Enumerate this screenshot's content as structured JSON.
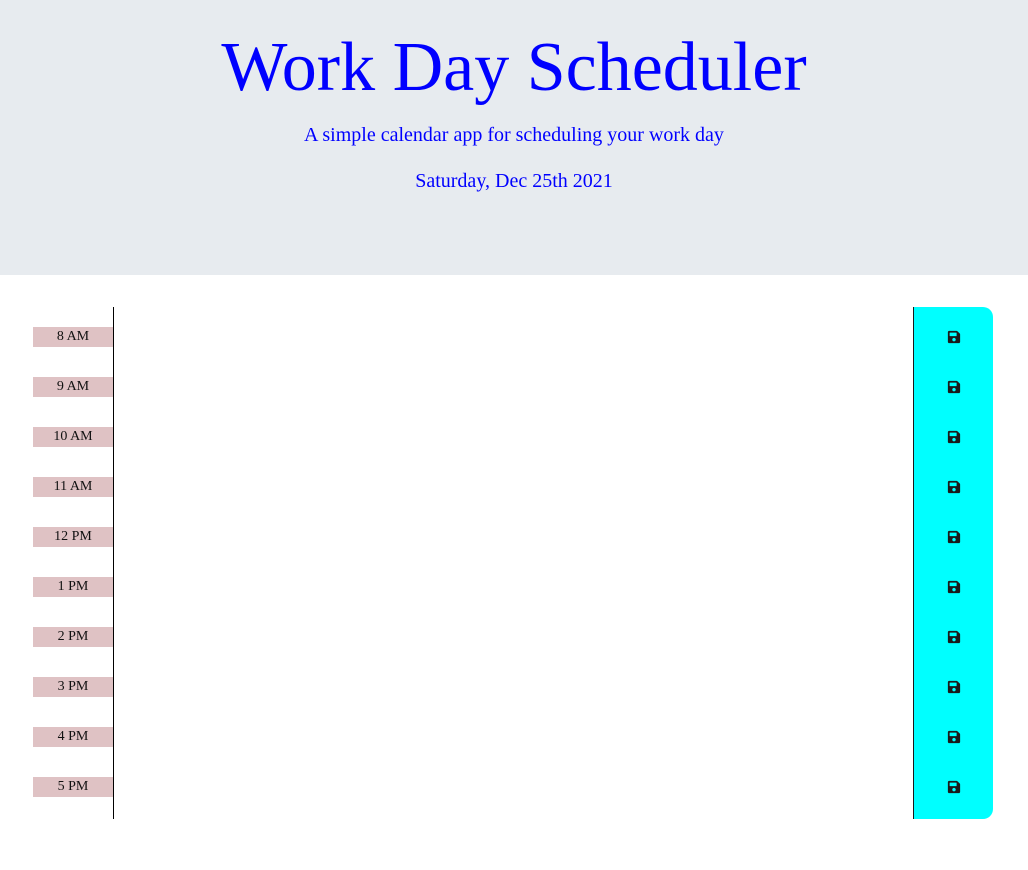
{
  "header": {
    "title": "Work Day Scheduler",
    "subtitle": "A simple calendar app for scheduling your work day",
    "current_day": "Saturday, Dec 25th 2021"
  },
  "colors": {
    "header_bg": "#e7ebef",
    "header_text": "#0000ff",
    "hour_label_bg": "#dfc2c4",
    "save_button_bg": "#00ffff"
  },
  "timeblocks": [
    {
      "hour": "8 AM",
      "description": "",
      "save_icon": "floppy-disk-icon"
    },
    {
      "hour": "9 AM",
      "description": "",
      "save_icon": "floppy-disk-icon"
    },
    {
      "hour": "10 AM",
      "description": "",
      "save_icon": "floppy-disk-icon"
    },
    {
      "hour": "11 AM",
      "description": "",
      "save_icon": "floppy-disk-icon"
    },
    {
      "hour": "12 PM",
      "description": "",
      "save_icon": "floppy-disk-icon"
    },
    {
      "hour": "1 PM",
      "description": "",
      "save_icon": "floppy-disk-icon"
    },
    {
      "hour": "2 PM",
      "description": "",
      "save_icon": "floppy-disk-icon"
    },
    {
      "hour": "3 PM",
      "description": "",
      "save_icon": "floppy-disk-icon"
    },
    {
      "hour": "4 PM",
      "description": "",
      "save_icon": "floppy-disk-icon"
    },
    {
      "hour": "5 PM",
      "description": "",
      "save_icon": "floppy-disk-icon"
    }
  ]
}
